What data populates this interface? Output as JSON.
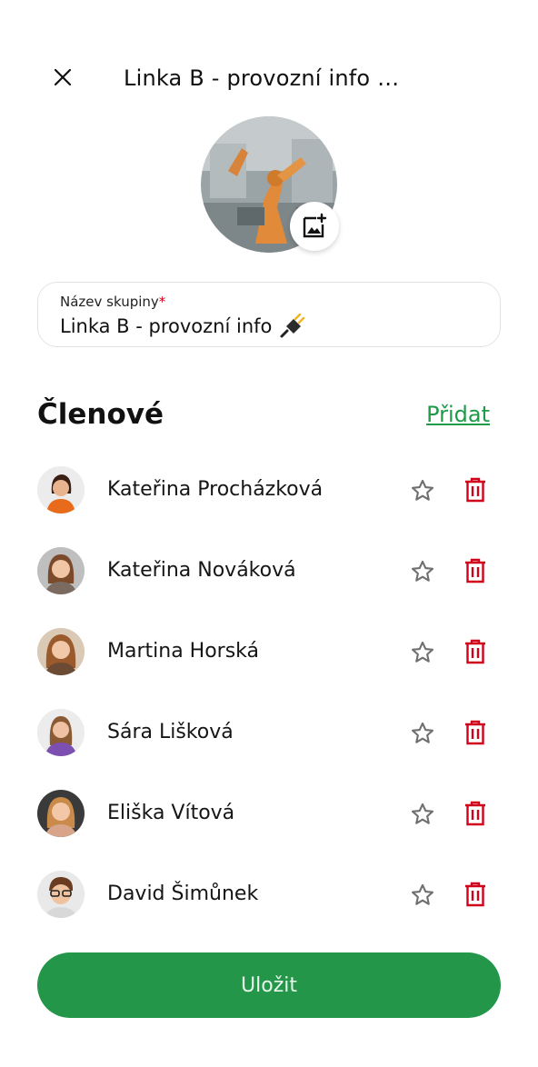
{
  "header": {
    "title": "Linka B - provozní info …"
  },
  "group": {
    "name_label": "Název skupiny",
    "required_mark": "*",
    "name_value": "Linka B - provozní info",
    "name_emoji_icon": "electric-plug-icon"
  },
  "members": {
    "title": "Členové",
    "add_label": "Přidat",
    "items": [
      {
        "name": "Kateřina Procházková"
      },
      {
        "name": "Kateřina Nováková"
      },
      {
        "name": "Martina Horská"
      },
      {
        "name": "Sára Lišková"
      },
      {
        "name": "Eliška Vítová"
      },
      {
        "name": "David Šimůnek"
      }
    ]
  },
  "actions": {
    "save_label": "Uložit"
  },
  "colors": {
    "accent_green": "#24964a",
    "link_green": "#1e9a49",
    "delete_red": "#d0021b",
    "star_gray": "#6f6f6f"
  }
}
